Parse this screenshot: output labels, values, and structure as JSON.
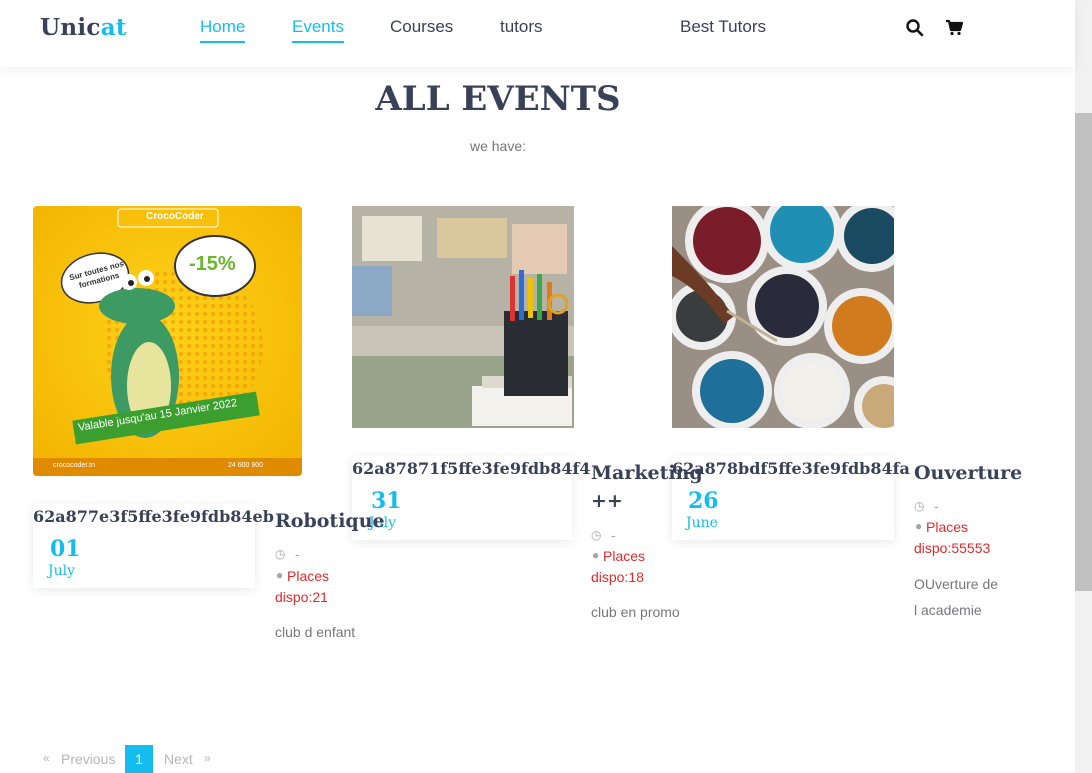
{
  "header": {
    "logo_main": "Unic",
    "logo_accent": "at",
    "nav": [
      "Home",
      "Events",
      "Courses",
      "tutors",
      "Best Tutors"
    ],
    "search_icon": "search-icon",
    "cart_icon": "cart-icon"
  },
  "page": {
    "title": "ALL EVENTS",
    "subtitle": "we have:"
  },
  "events": [
    {
      "id": "62a877e3f5ffe3fe9fdb84eb",
      "day": "01",
      "month": "July",
      "title": "Robotique",
      "time": "-",
      "places": "Places dispo:21",
      "description": "club d enfant",
      "image": {
        "brand": "CrocoCoder",
        "bubble_left": "Sur toutes nos formations",
        "bubble_right": "-15%",
        "banner": "Valable jusqu'au 15 Janvier 2022",
        "footer_left": "crococoder.tn",
        "footer_right": "24 600 900"
      }
    },
    {
      "id": "62a87871f5ffe3fe9fdb84f4",
      "day": "31",
      "month": "July",
      "title": "Marketing ++",
      "time": "-",
      "places": "Places dispo:18",
      "description": "club en promo"
    },
    {
      "id": "62a878bdf5ffe3fe9fdb84fa",
      "day": "26",
      "month": "June",
      "title": "Ouverture",
      "time": "-",
      "places": "Places dispo:55553",
      "description": "OUverture de l academie"
    }
  ],
  "pagination": {
    "prev_arrow": "«",
    "prev": "Previous",
    "current": "1",
    "next": "Next",
    "next_arrow": "»"
  },
  "colors": {
    "accent": "#14bdee",
    "heading": "#384158",
    "places": "#e02b2b"
  }
}
